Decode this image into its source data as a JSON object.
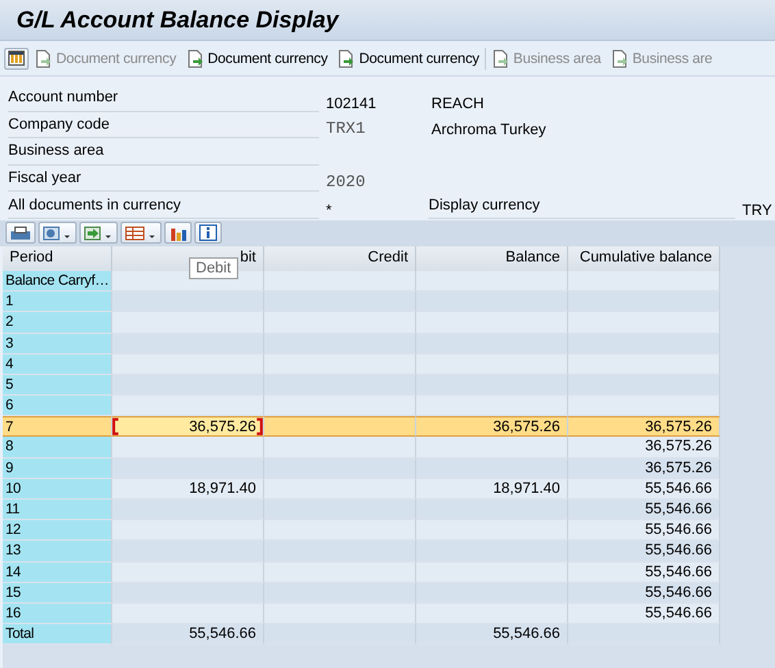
{
  "window": {
    "title": "G/L Account Balance Display"
  },
  "toolbar": [
    {
      "kind": "icon"
    },
    {
      "kind": "button",
      "label": "Document currency",
      "disabled": true
    },
    {
      "kind": "button",
      "label": "Document currency",
      "disabled": false
    },
    {
      "kind": "button",
      "label": "Document currency",
      "disabled": false
    },
    {
      "kind": "separator"
    },
    {
      "kind": "button",
      "label": "Business area",
      "disabled": true
    },
    {
      "kind": "button",
      "label": "Business are",
      "disabled": true
    }
  ],
  "header_fields": [
    {
      "label": "Account number",
      "value": "102141",
      "description": "REACH",
      "mono": false
    },
    {
      "label": "Company code",
      "value": "TRX1",
      "description": "Archroma Turkey",
      "mono": true
    },
    {
      "label": "Business area"
    },
    {
      "label": "Fiscal year",
      "value": "2020",
      "mono": true
    },
    {
      "label": "All documents in currency",
      "value": "*",
      "mono": false,
      "extra_label": "Display currency",
      "extra_value": "TRY"
    }
  ],
  "table": {
    "columns": [
      "Period",
      "bit",
      "Credit",
      "Balance",
      "Cumulative balance"
    ],
    "tooltip": "Debit",
    "rows": [
      {
        "selected": false,
        "cells": [
          {
            "text": "Balance Carryf…",
            "focused": false
          },
          {
            "text": "",
            "focused": false
          },
          {
            "text": "",
            "focused": false
          },
          {
            "text": "",
            "focused": false
          },
          {
            "text": "",
            "focused": false
          }
        ]
      },
      {
        "selected": false,
        "cells": [
          {
            "text": "1",
            "focused": false
          },
          {
            "text": "",
            "focused": false
          },
          {
            "text": "",
            "focused": false
          },
          {
            "text": "",
            "focused": false
          },
          {
            "text": "",
            "focused": false
          }
        ]
      },
      {
        "selected": false,
        "cells": [
          {
            "text": "2",
            "focused": false
          },
          {
            "text": "",
            "focused": false
          },
          {
            "text": "",
            "focused": false
          },
          {
            "text": "",
            "focused": false
          },
          {
            "text": "",
            "focused": false
          }
        ]
      },
      {
        "selected": false,
        "cells": [
          {
            "text": "3",
            "focused": false
          },
          {
            "text": "",
            "focused": false
          },
          {
            "text": "",
            "focused": false
          },
          {
            "text": "",
            "focused": false
          },
          {
            "text": "",
            "focused": false
          }
        ]
      },
      {
        "selected": false,
        "cells": [
          {
            "text": "4",
            "focused": false
          },
          {
            "text": "",
            "focused": false
          },
          {
            "text": "",
            "focused": false
          },
          {
            "text": "",
            "focused": false
          },
          {
            "text": "",
            "focused": false
          }
        ]
      },
      {
        "selected": false,
        "cells": [
          {
            "text": "5",
            "focused": false
          },
          {
            "text": "",
            "focused": false
          },
          {
            "text": "",
            "focused": false
          },
          {
            "text": "",
            "focused": false
          },
          {
            "text": "",
            "focused": false
          }
        ]
      },
      {
        "selected": false,
        "cells": [
          {
            "text": "6",
            "focused": false
          },
          {
            "text": "",
            "focused": false
          },
          {
            "text": "",
            "focused": false
          },
          {
            "text": "",
            "focused": false
          },
          {
            "text": "",
            "focused": false
          }
        ]
      },
      {
        "selected": true,
        "cells": [
          {
            "text": "7",
            "focused": false
          },
          {
            "text": "36,575.26",
            "focused": true
          },
          {
            "text": "",
            "focused": false
          },
          {
            "text": "36,575.26",
            "focused": false
          },
          {
            "text": "36,575.26",
            "focused": false
          }
        ]
      },
      {
        "selected": false,
        "cells": [
          {
            "text": "8",
            "focused": false
          },
          {
            "text": "",
            "focused": false
          },
          {
            "text": "",
            "focused": false
          },
          {
            "text": "",
            "focused": false
          },
          {
            "text": "36,575.26",
            "focused": false
          }
        ]
      },
      {
        "selected": false,
        "cells": [
          {
            "text": "9",
            "focused": false
          },
          {
            "text": "",
            "focused": false
          },
          {
            "text": "",
            "focused": false
          },
          {
            "text": "",
            "focused": false
          },
          {
            "text": "36,575.26",
            "focused": false
          }
        ]
      },
      {
        "selected": false,
        "cells": [
          {
            "text": "10",
            "focused": false
          },
          {
            "text": "18,971.40",
            "focused": false
          },
          {
            "text": "",
            "focused": false
          },
          {
            "text": "18,971.40",
            "focused": false
          },
          {
            "text": "55,546.66",
            "focused": false
          }
        ]
      },
      {
        "selected": false,
        "cells": [
          {
            "text": "11",
            "focused": false
          },
          {
            "text": "",
            "focused": false
          },
          {
            "text": "",
            "focused": false
          },
          {
            "text": "",
            "focused": false
          },
          {
            "text": "55,546.66",
            "focused": false
          }
        ]
      },
      {
        "selected": false,
        "cells": [
          {
            "text": "12",
            "focused": false
          },
          {
            "text": "",
            "focused": false
          },
          {
            "text": "",
            "focused": false
          },
          {
            "text": "",
            "focused": false
          },
          {
            "text": "55,546.66",
            "focused": false
          }
        ]
      },
      {
        "selected": false,
        "cells": [
          {
            "text": "13",
            "focused": false
          },
          {
            "text": "",
            "focused": false
          },
          {
            "text": "",
            "focused": false
          },
          {
            "text": "",
            "focused": false
          },
          {
            "text": "55,546.66",
            "focused": false
          }
        ]
      },
      {
        "selected": false,
        "cells": [
          {
            "text": "14",
            "focused": false
          },
          {
            "text": "",
            "focused": false
          },
          {
            "text": "",
            "focused": false
          },
          {
            "text": "",
            "focused": false
          },
          {
            "text": "55,546.66",
            "focused": false
          }
        ]
      },
      {
        "selected": false,
        "cells": [
          {
            "text": "15",
            "focused": false
          },
          {
            "text": "",
            "focused": false
          },
          {
            "text": "",
            "focused": false
          },
          {
            "text": "",
            "focused": false
          },
          {
            "text": "55,546.66",
            "focused": false
          }
        ]
      },
      {
        "selected": false,
        "cells": [
          {
            "text": "16",
            "focused": false
          },
          {
            "text": "",
            "focused": false
          },
          {
            "text": "",
            "focused": false
          },
          {
            "text": "",
            "focused": false
          },
          {
            "text": "55,546.66",
            "focused": false
          }
        ]
      },
      {
        "selected": false,
        "cells": [
          {
            "text": "Total",
            "focused": false
          },
          {
            "text": "55,546.66",
            "focused": false
          },
          {
            "text": "",
            "focused": false
          },
          {
            "text": "55,546.66",
            "focused": false
          },
          {
            "text": "",
            "focused": false
          }
        ]
      }
    ]
  }
}
